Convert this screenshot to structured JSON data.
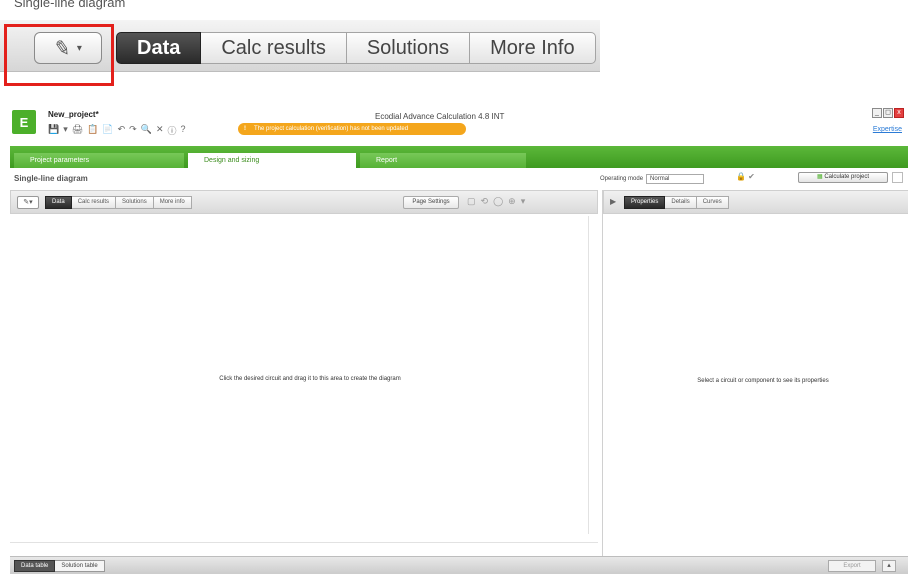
{
  "zoom": {
    "header_text": "Single-line diagram",
    "edit_caret": "▾",
    "tabs": [
      {
        "label": "Data",
        "active": true
      },
      {
        "label": "Calc results",
        "active": false
      },
      {
        "label": "Solutions",
        "active": false
      },
      {
        "label": "More Info",
        "active": false
      }
    ],
    "highlight_color": "#e3201b"
  },
  "app": {
    "logo_text": "E",
    "project_name": "New_project*",
    "title": "Ecodial Advance Calculation 4.8 INT",
    "warning": "The project calculation (verification) has not been updated",
    "expertise_link": "Expertise",
    "win_controls": [
      "_",
      "◻",
      "x"
    ],
    "toolbar_icons": [
      "💾",
      "▾",
      "🖨",
      "📋",
      "📄",
      "↶",
      "↷",
      "🔍",
      "✕",
      "ⓘ",
      "?"
    ],
    "main_tabs": [
      {
        "label": "Project parameters",
        "active": false
      },
      {
        "label": "Design and sizing",
        "active": true
      },
      {
        "label": "Report",
        "active": false
      }
    ],
    "sld_title": "Single-line diagram",
    "operating_mode_label": "Operating mode",
    "operating_mode_value": "Normal",
    "calc_button": "Calculate project",
    "left": {
      "edit_btn": "✎▾",
      "tabs": [
        {
          "label": "Data",
          "active": true
        },
        {
          "label": "Calc results",
          "active": false
        },
        {
          "label": "Solutions",
          "active": false
        },
        {
          "label": "More info",
          "active": false
        }
      ],
      "page_settings": "Page Settings",
      "canvas_tools": [
        "▢",
        "⟲",
        "◯",
        "⊕",
        "▾"
      ],
      "hint": "Click the desired circuit and drag it to this area to create the diagram"
    },
    "right": {
      "tabs": [
        {
          "label": "Properties",
          "active": true
        },
        {
          "label": "Details",
          "active": false
        },
        {
          "label": "Curves",
          "active": false
        }
      ],
      "hint": "Select a circuit or component to see its properties"
    },
    "bottom": {
      "tabs": [
        {
          "label": "Data table",
          "active": true
        },
        {
          "label": "Solution table",
          "active": false
        }
      ],
      "export": "Export",
      "collapse": "▴"
    },
    "colors": {
      "accent_green": "#4caf2a",
      "warning_orange": "#f4a61c"
    }
  }
}
